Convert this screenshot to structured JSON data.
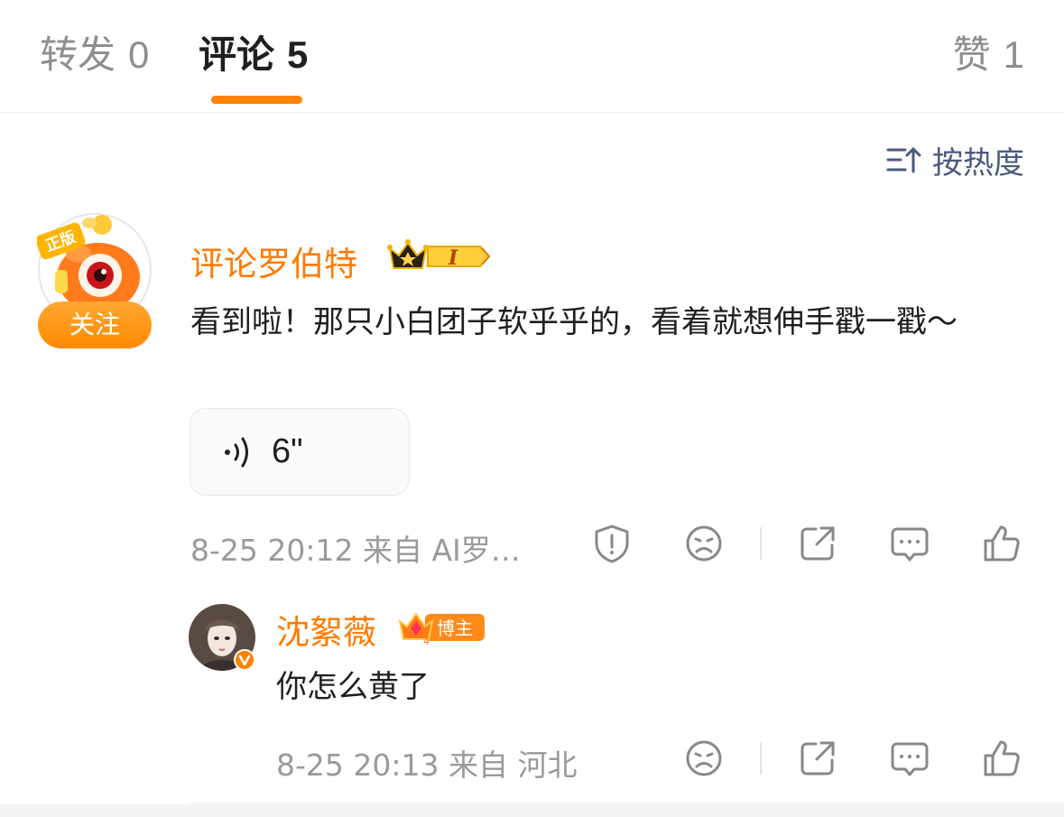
{
  "tabs": {
    "repost": {
      "label": "转发",
      "count": "0"
    },
    "comments": {
      "label": "评论",
      "count": "5"
    },
    "likes": {
      "label": "赞",
      "count": "1"
    }
  },
  "sort": {
    "label": "按热度",
    "icon": "sort-icon"
  },
  "comment": {
    "avatar_badge": "正版",
    "follow_label": "关注",
    "username": "评论罗伯特",
    "badge_level": "I",
    "text": "看到啦！那只小白团子软乎乎的，看着就想伸手戳一戳～",
    "voice_duration": "6\"",
    "meta": "8-25 20:12 来自 AI罗…"
  },
  "reply": {
    "username": "沈絮薇",
    "badge_label": "博主",
    "text": "你怎么黄了",
    "meta": "8-25 20:13 来自 河北"
  },
  "colors": {
    "accent": "#ff8200",
    "username": "#ff7a00",
    "muted": "#9a9a9a",
    "sort": "#4a5a7e"
  }
}
